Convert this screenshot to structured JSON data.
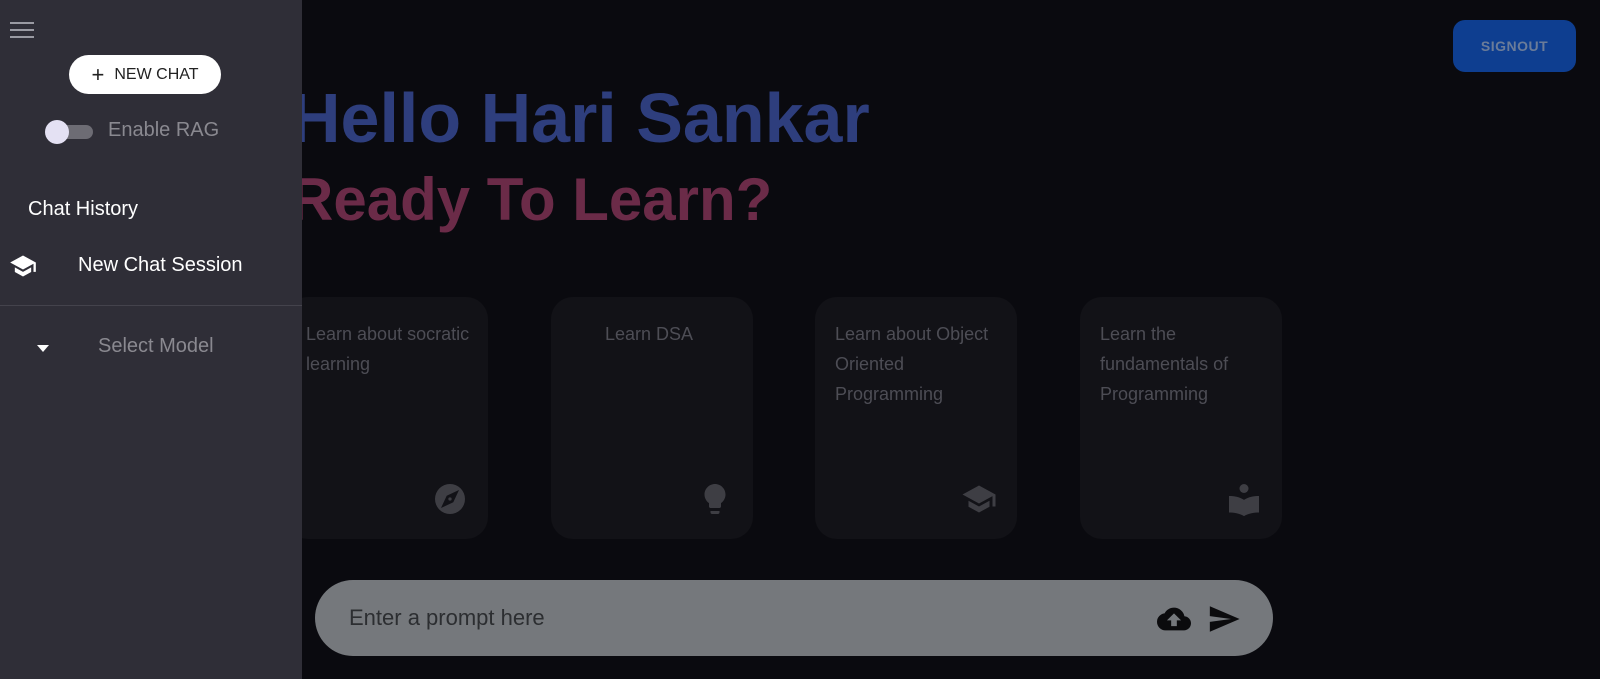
{
  "header": {
    "signout_label": "SIGNOUT"
  },
  "greeting": {
    "title": "Hello Hari Sankar",
    "subtitle": "Ready To Learn?"
  },
  "cards": [
    {
      "text": "Learn about socratic learning",
      "icon": "compass-icon"
    },
    {
      "text": "Learn DSA",
      "icon": "lightbulb-icon"
    },
    {
      "text": "Learn about Object Oriented Programming",
      "icon": "school-icon"
    },
    {
      "text": "Learn the fundamentals of Programming",
      "icon": "reading-icon"
    }
  ],
  "prompt": {
    "placeholder": "Enter a prompt here",
    "value": ""
  },
  "sidebar": {
    "new_chat_label": "NEW CHAT",
    "rag_label": "Enable RAG",
    "rag_enabled": false,
    "history_title": "Chat History",
    "history_items": [
      {
        "label": "New Chat Session",
        "icon": "school-icon"
      }
    ],
    "model_select_label": "Select Model"
  },
  "colors": {
    "signout_bg": "#0e3e90",
    "greeting": "#2e3e7d",
    "subgreeting": "#6b2b48",
    "sidebar_bg": "#2f2e37",
    "prompt_bg": "#75787c"
  }
}
